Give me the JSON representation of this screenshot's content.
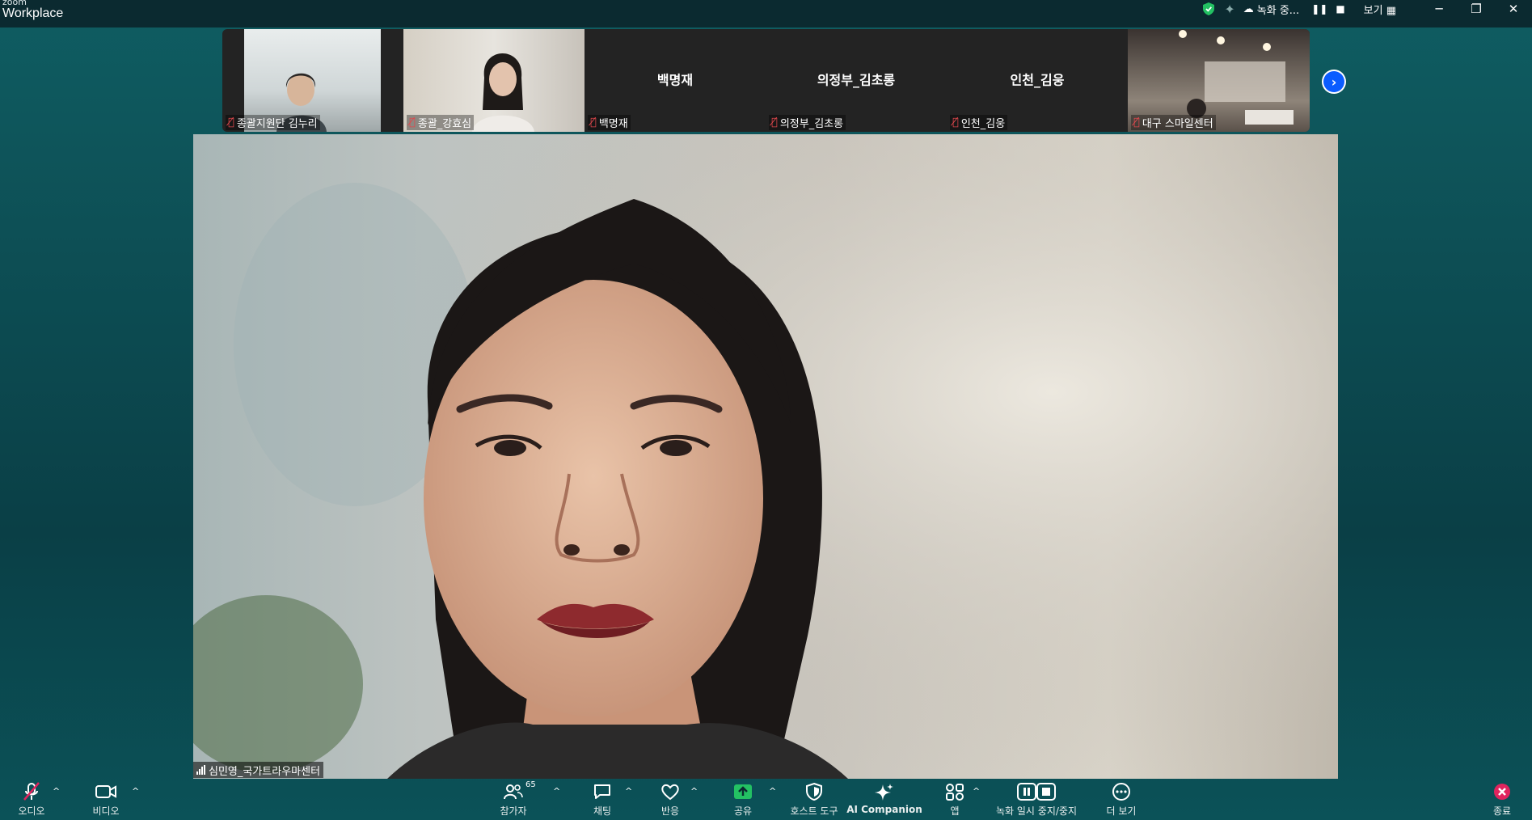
{
  "app": {
    "brand_small": "zoom",
    "brand_big": "Workplace"
  },
  "titlebar": {
    "recording_label": "녹화 중...",
    "view_label": "보기",
    "minimize": "─",
    "restore": "❐",
    "close": "✕"
  },
  "participants_strip": [
    {
      "name": "종괄지원단 김누리",
      "has_video": true
    },
    {
      "name": "종괄_강효심",
      "has_video": true
    },
    {
      "name": "백명재",
      "center_label": "백명재",
      "has_video": false
    },
    {
      "name": "의정부_김초롱",
      "center_label": "의정부_김초롱",
      "has_video": false
    },
    {
      "name": "인천_김웅",
      "center_label": "인천_김웅",
      "has_video": false
    },
    {
      "name": "대구 스마일센터",
      "has_video": true
    }
  ],
  "main_speaker": {
    "name": "심민영_국가트라우마센터"
  },
  "toolbar": {
    "audio": "오디오",
    "video": "비디오",
    "participants": "참가자",
    "participants_count": "65",
    "chat": "채팅",
    "reactions": "반응",
    "share": "공유",
    "host_tools": "호스트 도구",
    "ai_companion": "AI Companion",
    "apps": "앱",
    "recording": "녹화 일시 중지/중지",
    "more": "더 보기",
    "end": "종료"
  },
  "colors": {
    "accent_blue": "#0b5cff",
    "share_green": "#23c163",
    "end_red": "#e0245e",
    "mute_red": "#e0484d"
  }
}
